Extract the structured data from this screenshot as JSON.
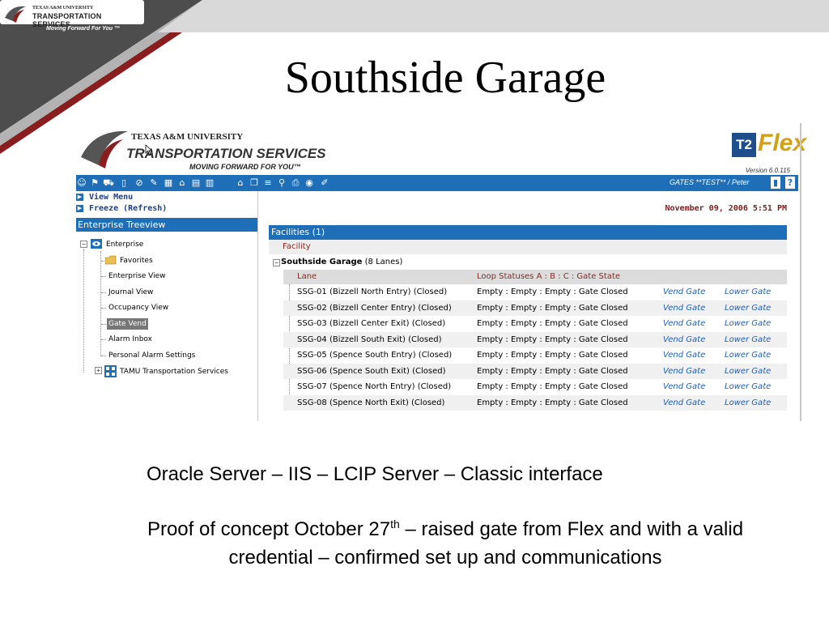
{
  "slide": {
    "logo_small": "TEXAS A&M UNIVERSITY",
    "logo_big": "TRANSPORTATION SERVICES",
    "tagline": "Moving Forward For You ™",
    "title": "Southside Garage",
    "bullet1": "Oracle Server – IIS – LCIP Server – Classic interface",
    "bullet2_pre": "Proof of concept October 27",
    "bullet2_sup": "th",
    "bullet2_post": " – raised gate from Flex and with a valid credential – confirmed set up and communications"
  },
  "app": {
    "header": {
      "university": "TEXAS A&M UNIVERSITY",
      "service": "TRANSPORTATION SERVICES",
      "motto": "MOVING FORWARD FOR YOU™",
      "product_t2": "T2",
      "product_flex": "Flex",
      "version": "Version 6.0.115"
    },
    "toolbar": {
      "user": "GATES **TEST** / Peter",
      "icons": [
        "person-icon",
        "sign-icon",
        "car-icon",
        "meter-icon",
        "no-entry-icon",
        "wrench-icon",
        "building-icon",
        "bank-icon",
        "document-icon",
        "calendar-icon",
        "home-icon",
        "pages-icon",
        "stack-icon",
        "magnifier-icon",
        "print-icon",
        "eye-icon",
        "edit-icon",
        "logout-icon",
        "help-icon"
      ]
    },
    "nav": {
      "view_menu": "View Menu",
      "freeze": "Freeze  (Refresh)"
    },
    "tree": {
      "header": "Enterprise Treeview",
      "root": "Enterprise",
      "items": [
        "Favorites",
        "Enterprise View",
        "Journal View",
        "Occupancy View",
        "Gate Vend",
        "Alarm Inbox",
        "Personal Alarm Settings"
      ],
      "selected": "Gate Vend",
      "child_root": "TAMU Transportation Services"
    },
    "date": "November 09, 2006 5:51 PM",
    "facilities": {
      "header": "Facilities (1)",
      "column": "Facility",
      "garage_name": "Southside Garage",
      "garage_lanes": "(8 Lanes)",
      "lane_col": "Lane",
      "status_col": "Loop Statuses A : B : C : Gate State",
      "lanes": [
        {
          "name": "SSG-01 (Bizzell North Entry) (Closed)",
          "status": "Empty : Empty : Empty : Gate Closed",
          "vend": "Vend Gate",
          "lower": "Lower Gate"
        },
        {
          "name": "SSG-02 (Bizzell Center Entry) (Closed)",
          "status": "Empty : Empty : Empty : Gate Closed",
          "vend": "Vend Gate",
          "lower": "Lower Gate"
        },
        {
          "name": "SSG-03 (Bizzell Center Exit) (Closed)",
          "status": "Empty : Empty : Empty : Gate Closed",
          "vend": "Vend Gate",
          "lower": "Lower Gate"
        },
        {
          "name": "SSG-04 (Bizzell South Exit) (Closed)",
          "status": "Empty : Empty : Empty : Gate Closed",
          "vend": "Vend Gate",
          "lower": "Lower Gate"
        },
        {
          "name": "SSG-05 (Spence South Entry) (Closed)",
          "status": "Empty : Empty : Empty : Gate Closed",
          "vend": "Vend Gate",
          "lower": "Lower Gate"
        },
        {
          "name": "SSG-06 (Spence South Exit) (Closed)",
          "status": "Empty : Empty : Empty : Gate Closed",
          "vend": "Vend Gate",
          "lower": "Lower Gate"
        },
        {
          "name": "SSG-07 (Spence North Entry) (Closed)",
          "status": "Empty : Empty : Empty : Gate Closed",
          "vend": "Vend Gate",
          "lower": "Lower Gate"
        },
        {
          "name": "SSG-08 (Spence North Exit) (Closed)",
          "status": "Empty : Empty : Empty : Gate Closed",
          "vend": "Vend Gate",
          "lower": "Lower Gate"
        }
      ]
    }
  },
  "colors": {
    "toolbar_blue": "#1e6fb8",
    "link_blue": "#1e5fb8",
    "date_red": "#7a1e1e",
    "header_maroon": "#8a2a1e",
    "flex_gold": "#d4a017"
  }
}
